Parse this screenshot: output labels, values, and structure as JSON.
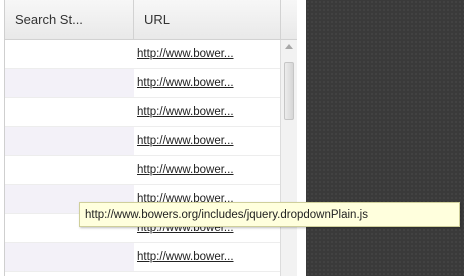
{
  "grid": {
    "columns": [
      "Search St...",
      "URL"
    ],
    "rows": [
      {
        "search": "",
        "url": "http://www.bower..."
      },
      {
        "search": "",
        "url": "http://www.bower..."
      },
      {
        "search": "",
        "url": "http://www.bower..."
      },
      {
        "search": "",
        "url": "http://www.bower..."
      },
      {
        "search": "",
        "url": "http://www.bower..."
      },
      {
        "search": "",
        "url": "http://www.bower..."
      },
      {
        "search": "",
        "url": "http://www.bower..."
      },
      {
        "search": "",
        "url": "http://www.bower..."
      }
    ]
  },
  "tooltip": {
    "text": "http://www.bowers.org/includes/jquery.dropdownPlain.js"
  }
}
